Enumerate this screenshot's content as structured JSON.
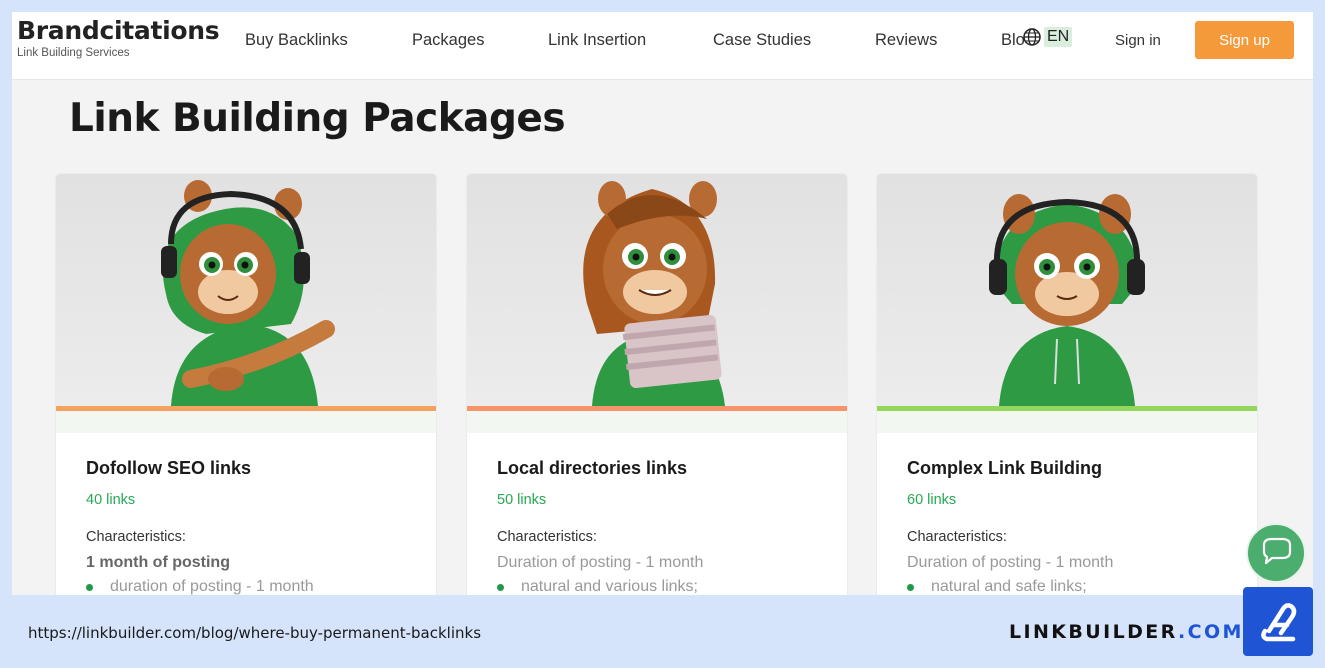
{
  "header": {
    "brand_name": "Brandcitations",
    "brand_sub": "Link Building Services",
    "nav": [
      "Buy Backlinks",
      "Packages",
      "Link Insertion",
      "Case Studies",
      "Reviews",
      "Blog"
    ],
    "lang": "EN",
    "signin": "Sign in",
    "signup": "Sign up"
  },
  "page": {
    "title": "Link Building Packages"
  },
  "cards": [
    {
      "title": "Dofollow SEO links",
      "links": "40 links",
      "characteristics": "Characteristics:",
      "duration": "1 month of posting",
      "bullet": "duration of posting - 1 month",
      "accent": "#f5a25e"
    },
    {
      "title": "Local directories links",
      "links": "50 links",
      "characteristics": "Characteristics:",
      "duration": "Duration of posting - 1 month",
      "bullet": "natural and various links;",
      "accent": "#f7936a"
    },
    {
      "title": "Complex Link Building",
      "links": "60 links",
      "characteristics": "Characteristics:",
      "duration": "Duration of posting - 1 month",
      "bullet": "natural and safe links;",
      "accent": "#93d65a"
    }
  ],
  "footer": {
    "url": "https://linkbuilder.com/blog/where-buy-permanent-backlinks",
    "brand_main": "LINKBUILDER",
    "brand_tld": ".COM"
  },
  "colors": {
    "signup": "#f59a3a",
    "links_green": "#27a854",
    "footer_bg": "#d5e3fb",
    "brand_blue": "#1f55d4"
  }
}
